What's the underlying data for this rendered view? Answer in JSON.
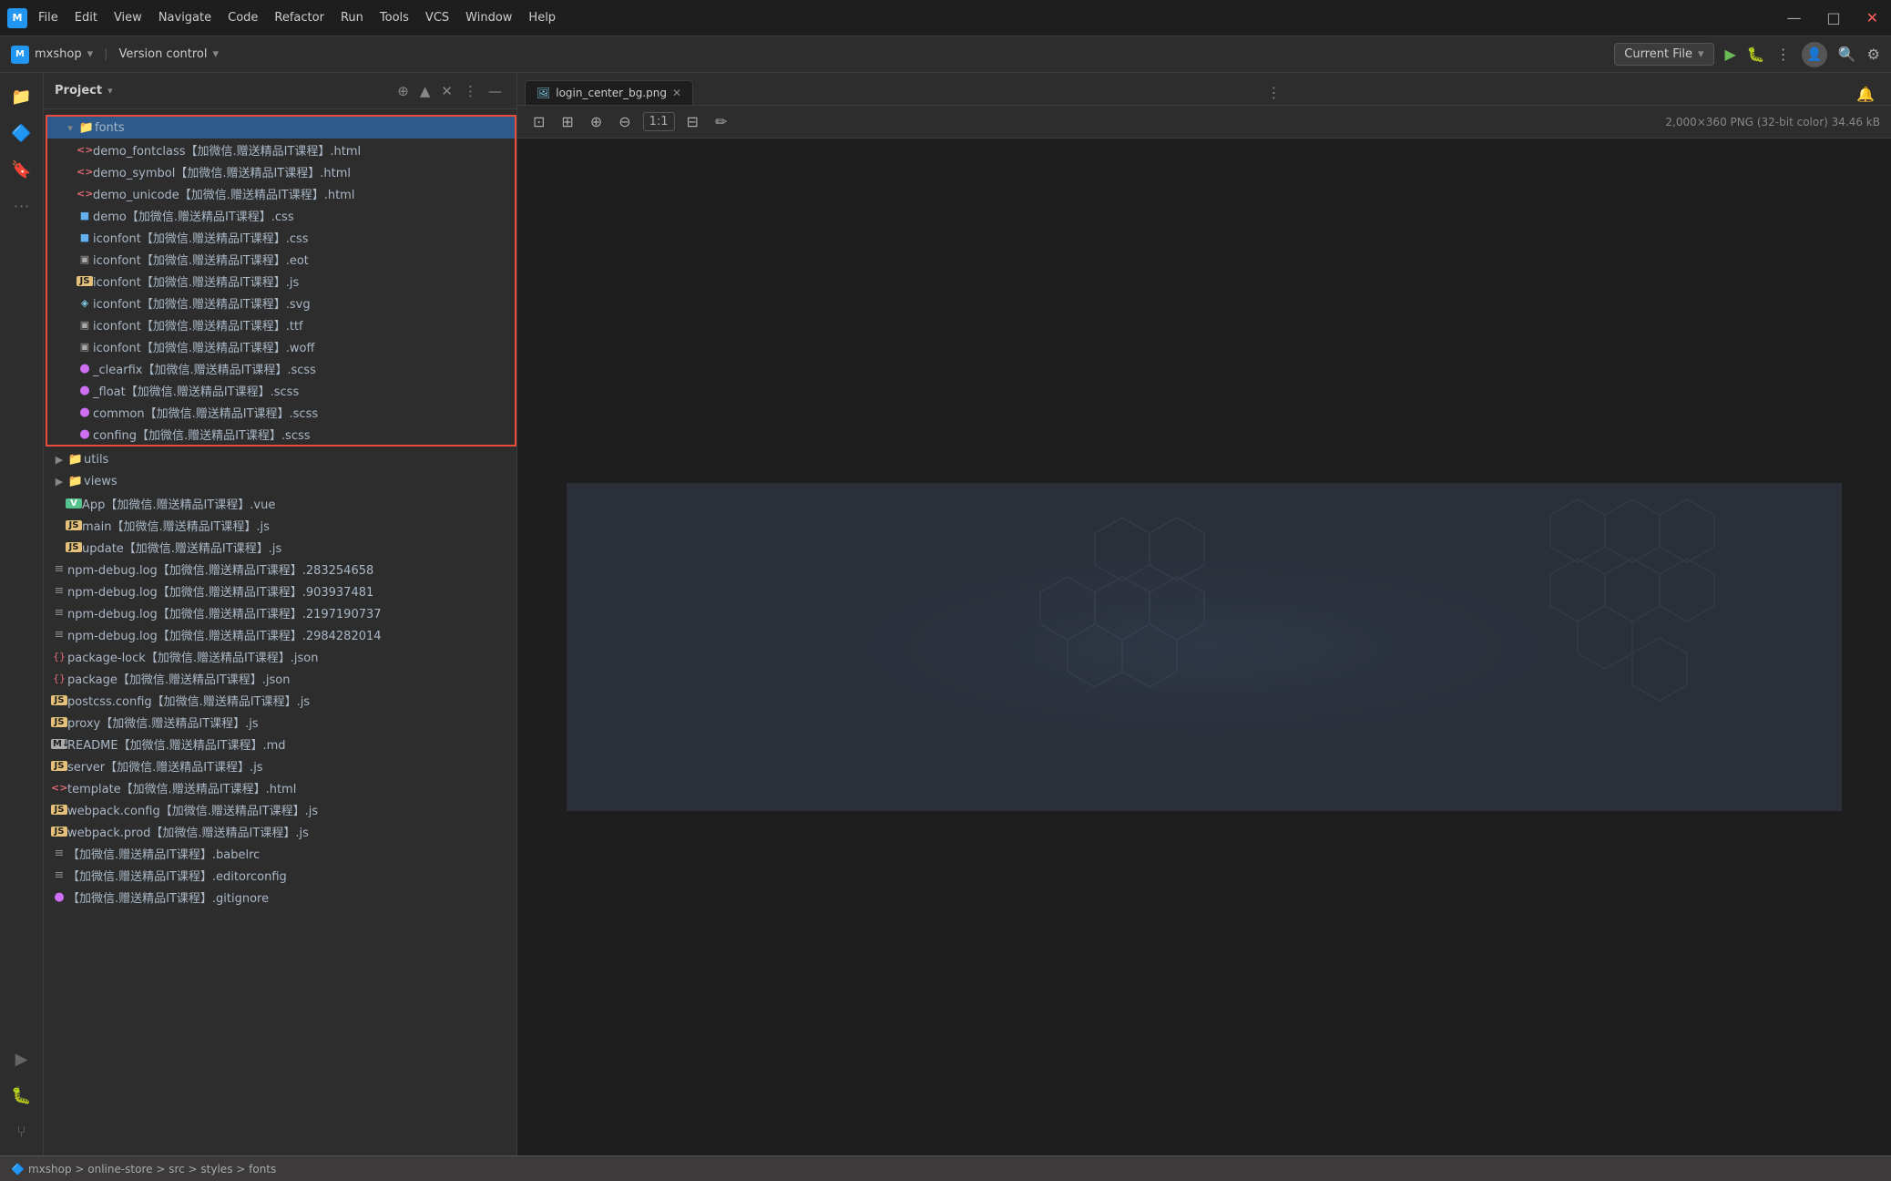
{
  "titleBar": {
    "logo": "M",
    "menus": [
      "File",
      "Edit",
      "View",
      "Navigate",
      "Code",
      "Refactor",
      "Run",
      "Tools",
      "VCS",
      "Window",
      "Help"
    ],
    "workspace": "mxshop",
    "vcs": "Version control",
    "currentFile": "Current File",
    "runBtn": "▶",
    "winMinimize": "—",
    "winMaximize": "□",
    "winClose": "✕"
  },
  "sidebar": {
    "title": "Project",
    "breadcrumb": "mxshop > online-store > src > styles > fonts",
    "tree": [
      {
        "id": "fonts",
        "label": "fonts",
        "type": "folder",
        "open": true,
        "indent": 1,
        "selected": true
      },
      {
        "id": "demo_fontclass_html",
        "label": "demo_fontclass【加微信.赠送精品IT课程】.html",
        "type": "html",
        "indent": 2
      },
      {
        "id": "demo_symbol_html",
        "label": "demo_symbol【加微信.赠送精品IT课程】.html",
        "type": "html",
        "indent": 2
      },
      {
        "id": "demo_unicode_html",
        "label": "demo_unicode【加微信.赠送精品IT课程】.html",
        "type": "html",
        "indent": 2
      },
      {
        "id": "demo_css",
        "label": "demo【加微信.赠送精品IT课程】.css",
        "type": "css",
        "indent": 2
      },
      {
        "id": "iconfont_css",
        "label": "iconfont【加微信.赠送精品IT课程】.css",
        "type": "css",
        "indent": 2
      },
      {
        "id": "iconfont_eot",
        "label": "iconfont【加微信.赠送精品IT课程】.eot",
        "type": "eot",
        "indent": 2
      },
      {
        "id": "iconfont_js",
        "label": "iconfont【加微信.赠送精品IT课程】.js",
        "type": "js",
        "indent": 2
      },
      {
        "id": "iconfont_svg",
        "label": "iconfont【加微信.赠送精品IT课程】.svg",
        "type": "svg",
        "indent": 2
      },
      {
        "id": "iconfont_ttf",
        "label": "iconfont【加微信.赠送精品IT课程】.ttf",
        "type": "ttf",
        "indent": 2
      },
      {
        "id": "iconfont_woff",
        "label": "iconfont【加微信.赠送精品IT课程】.woff",
        "type": "woff",
        "indent": 2
      },
      {
        "id": "clearfix_scss",
        "label": "_clearfix【加微信.赠送精品IT课程】.scss",
        "type": "scss",
        "indent": 2
      },
      {
        "id": "float_scss",
        "label": "_float【加微信.赠送精品IT课程】.scss",
        "type": "scss",
        "indent": 2
      },
      {
        "id": "common_scss",
        "label": "common【加微信.赠送精品IT课程】.scss",
        "type": "scss",
        "indent": 2
      },
      {
        "id": "confing_scss",
        "label": "confing【加微信.赠送精品IT课程】.scss",
        "type": "scss",
        "indent": 2
      },
      {
        "id": "utils",
        "label": "utils",
        "type": "folder",
        "open": false,
        "indent": 1
      },
      {
        "id": "views",
        "label": "views",
        "type": "folder",
        "open": false,
        "indent": 1
      },
      {
        "id": "app_vue",
        "label": "App【加微信.赠送精品IT课程】.vue",
        "type": "vue",
        "indent": 2
      },
      {
        "id": "main_js",
        "label": "main【加微信.赠送精品IT课程】.js",
        "type": "js",
        "indent": 2
      },
      {
        "id": "update_js",
        "label": "update【加微信.赠送精品IT课程】.js",
        "type": "js",
        "indent": 2
      },
      {
        "id": "npm_debug1",
        "label": "npm-debug.log【加微信.赠送精品IT课程】.283254658",
        "type": "log",
        "indent": 1
      },
      {
        "id": "npm_debug2",
        "label": "npm-debug.log【加微信.赠送精品IT课程】.903937481",
        "type": "log",
        "indent": 1
      },
      {
        "id": "npm_debug3",
        "label": "npm-debug.log【加微信.赠送精品IT课程】.2197190737",
        "type": "log",
        "indent": 1
      },
      {
        "id": "npm_debug4",
        "label": "npm-debug.log【加微信.赠送精品IT课程】.2984282014",
        "type": "log",
        "indent": 1
      },
      {
        "id": "package_lock_json",
        "label": "package-lock【加微信.赠送精品IT课程】.json",
        "type": "json",
        "indent": 1
      },
      {
        "id": "package_json",
        "label": "package【加微信.赠送精品IT课程】.json",
        "type": "json",
        "indent": 1
      },
      {
        "id": "postcss_config_js",
        "label": "postcss.config【加微信.赠送精品IT课程】.js",
        "type": "js",
        "indent": 1
      },
      {
        "id": "proxy_js",
        "label": "proxy【加微信.赠送精品IT课程】.js",
        "type": "js",
        "indent": 1
      },
      {
        "id": "readme_md",
        "label": "README【加微信.赠送精品IT课程】.md",
        "type": "md",
        "indent": 1
      },
      {
        "id": "server_js",
        "label": "server【加微信.赠送精品IT课程】.js",
        "type": "js",
        "indent": 1
      },
      {
        "id": "template_html",
        "label": "template【加微信.赠送精品IT课程】.html",
        "type": "html",
        "indent": 1
      },
      {
        "id": "webpack_config_js",
        "label": "webpack.config【加微信.赠送精品IT课程】.js",
        "type": "js",
        "indent": 1
      },
      {
        "id": "webpack_prod_js",
        "label": "webpack.prod【加微信.赠送精品IT课程】.js",
        "type": "js",
        "indent": 1
      },
      {
        "id": "babelrc",
        "label": "【加微信.赠送精品IT课程】.babelrc",
        "type": "txt",
        "indent": 1
      },
      {
        "id": "editorconfig",
        "label": "【加微信.赠送精品IT课程】.editorconfig",
        "type": "txt",
        "indent": 1
      },
      {
        "id": "gitignore",
        "label": "【加微信.赠送精品IT课程】.gitignore",
        "type": "generic",
        "indent": 1
      }
    ]
  },
  "editor": {
    "tab": "login_center_bg.png",
    "imageInfo": "2,000×360 PNG (32-bit color) 34.46 kB",
    "zoomLabel": "1:1"
  },
  "statusBar": {
    "path": "mxshop > online-store > src > styles > fonts"
  },
  "icons": {
    "search": "🔍",
    "gear": "⚙",
    "bell": "🔔",
    "expand": "⬡",
    "collapse": "⬡",
    "close": "✕",
    "more": "⋯",
    "minus": "—",
    "maximize": "□"
  }
}
